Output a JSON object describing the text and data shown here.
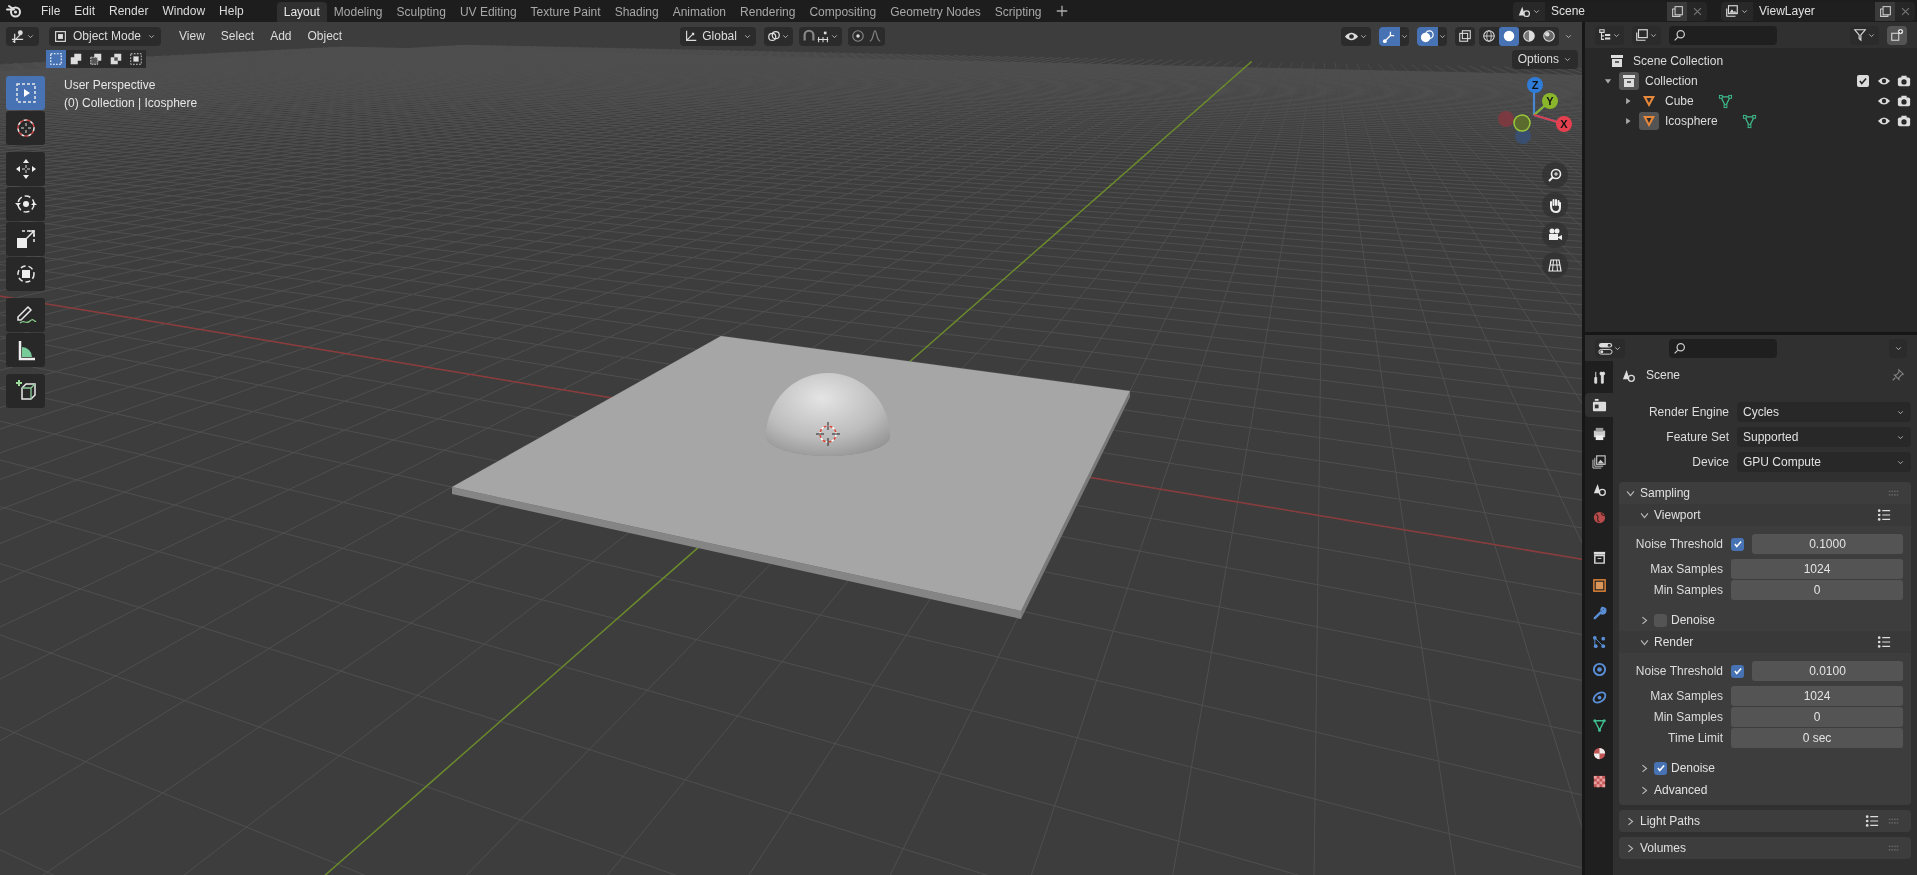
{
  "menu": [
    "File",
    "Edit",
    "Render",
    "Window",
    "Help"
  ],
  "workspaces": [
    {
      "label": "Layout",
      "selected": true
    },
    {
      "label": "Modeling",
      "selected": false
    },
    {
      "label": "Sculpting",
      "selected": false
    },
    {
      "label": "UV Editing",
      "selected": false
    },
    {
      "label": "Texture Paint",
      "selected": false
    },
    {
      "label": "Shading",
      "selected": false
    },
    {
      "label": "Animation",
      "selected": false
    },
    {
      "label": "Rendering",
      "selected": false
    },
    {
      "label": "Compositing",
      "selected": false
    },
    {
      "label": "Geometry Nodes",
      "selected": false
    },
    {
      "label": "Scripting",
      "selected": false
    }
  ],
  "scene": "Scene",
  "view_layer": "ViewLayer",
  "viewport_header": {
    "mode": "Object Mode",
    "menus": [
      "View",
      "Select",
      "Add",
      "Object"
    ],
    "orientation": "Global",
    "gizmos_on": true,
    "overlays_on": true,
    "shading_modes": [
      {
        "kind": "wireframe",
        "selected": false
      },
      {
        "kind": "solid",
        "selected": true
      },
      {
        "kind": "material",
        "selected": false
      },
      {
        "kind": "rendered",
        "selected": false
      }
    ]
  },
  "select_modes": [
    {
      "kind": "set",
      "selected": true
    },
    {
      "kind": "extend",
      "selected": false
    },
    {
      "kind": "subtract",
      "selected": false
    },
    {
      "kind": "difference",
      "selected": false
    },
    {
      "kind": "intersect",
      "selected": false
    }
  ],
  "options_label": "Options",
  "viewport_info": {
    "view": "User Perspective",
    "context": "(0) Collection | Icosphere"
  },
  "tools": [
    {
      "kind": "select",
      "selected": true
    },
    {
      "kind": "cursor",
      "selected": false
    },
    {
      "kind": "move",
      "selected": false
    },
    {
      "kind": "rotate",
      "selected": false
    },
    {
      "kind": "scale",
      "selected": false
    },
    {
      "kind": "transform",
      "selected": false
    },
    {
      "kind": "annotate",
      "selected": false
    },
    {
      "kind": "measure",
      "selected": false
    },
    {
      "kind": "add-cube",
      "selected": false
    }
  ],
  "gizmo": {
    "x": "X",
    "y": "Y",
    "z": "Z"
  },
  "outliner": {
    "items": [
      {
        "label": "Scene Collection",
        "kind": "scene-collection",
        "children": [
          {
            "label": "Collection",
            "kind": "collection",
            "expanded": true,
            "checked": true,
            "active": true,
            "children": [
              {
                "label": "Cube",
                "kind": "object",
                "expanded": false,
                "active": false
              },
              {
                "label": "Icosphere",
                "kind": "object",
                "expanded": false,
                "active": true
              }
            ]
          }
        ]
      }
    ]
  },
  "properties": {
    "tabs": [
      {
        "kind": "tool",
        "selected": false
      },
      {
        "kind": "render",
        "selected": true
      },
      {
        "kind": "output",
        "selected": false
      },
      {
        "kind": "view-layer",
        "selected": false
      },
      {
        "kind": "scene",
        "selected": false
      },
      {
        "kind": "world",
        "selected": false
      },
      {
        "kind": "collection",
        "selected": false
      },
      {
        "kind": "object",
        "selected": false
      },
      {
        "kind": "modifiers",
        "selected": false
      },
      {
        "kind": "particles",
        "selected": false
      },
      {
        "kind": "physics",
        "selected": false
      },
      {
        "kind": "constraints",
        "selected": false
      },
      {
        "kind": "data",
        "selected": false
      },
      {
        "kind": "material",
        "selected": false
      },
      {
        "kind": "texture",
        "selected": false
      }
    ],
    "context": "Scene",
    "settings": [
      {
        "label": "Render Engine",
        "value": "Cycles"
      },
      {
        "label": "Feature Set",
        "value": "Supported"
      },
      {
        "label": "Device",
        "value": "GPU Compute"
      }
    ],
    "panels": [
      {
        "label": "Sampling",
        "expanded": true,
        "children": [
          {
            "label": "Viewport",
            "expanded": true,
            "presets": true,
            "rows": [
              {
                "kind": "toggle-number",
                "label": "Noise Threshold",
                "checked": true,
                "value": "0.1000"
              },
              {
                "kind": "number",
                "label": "Max Samples",
                "value": "1024"
              },
              {
                "kind": "number",
                "label": "Min Samples",
                "value": "0"
              }
            ],
            "children": [
              {
                "label": "Denoise",
                "expanded": false,
                "checked": false
              }
            ]
          },
          {
            "label": "Render",
            "expanded": true,
            "presets": true,
            "rows": [
              {
                "kind": "toggle-number",
                "label": "Noise Threshold",
                "checked": true,
                "value": "0.0100"
              },
              {
                "kind": "number",
                "label": "Max Samples",
                "value": "1024"
              },
              {
                "kind": "number",
                "label": "Min Samples",
                "value": "0"
              },
              {
                "kind": "number",
                "label": "Time Limit",
                "value": "0 sec"
              }
            ],
            "children": [
              {
                "label": "Denoise",
                "expanded": false,
                "checked": true
              }
            ]
          },
          {
            "label": "Advanced",
            "expanded": false
          }
        ]
      },
      {
        "label": "Light Paths",
        "expanded": false,
        "presets": true
      },
      {
        "label": "Volumes",
        "expanded": false
      }
    ]
  }
}
